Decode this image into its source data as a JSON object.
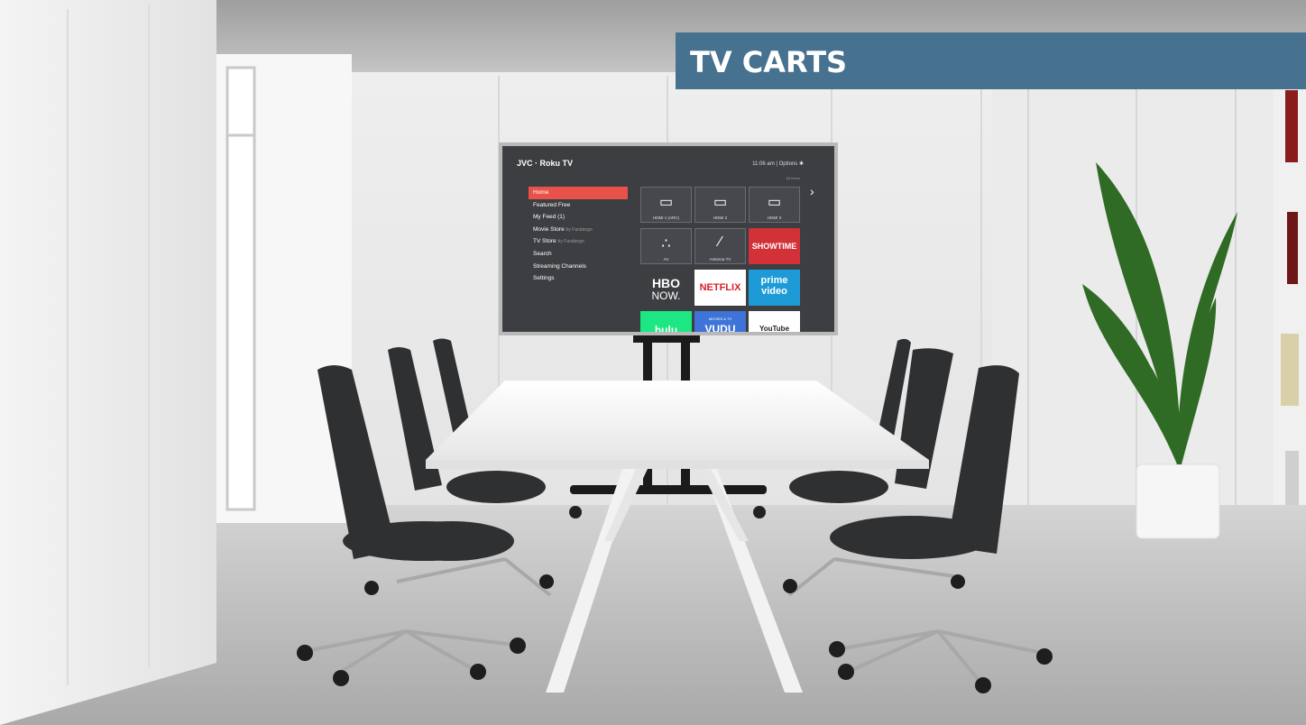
{
  "banner": {
    "title": "TV CARTS"
  },
  "tv": {
    "brand": "JVC · Roku TV",
    "time": "11:06 am  |  Options ✱",
    "items_count": "65 Items",
    "menu": [
      {
        "label": "Home",
        "sub": ""
      },
      {
        "label": "Featured Free",
        "sub": ""
      },
      {
        "label": "My Feed (1)",
        "sub": ""
      },
      {
        "label": "Movie Store",
        "sub": "by Fandango"
      },
      {
        "label": "TV Store",
        "sub": "by Fandango"
      },
      {
        "label": "Search",
        "sub": ""
      },
      {
        "label": "Streaming Channels",
        "sub": ""
      },
      {
        "label": "Settings",
        "sub": ""
      }
    ],
    "tiles": {
      "hdmi1": "HDMI 1 (ARC)",
      "hdmi2": "HDMI 2",
      "hdmi3": "HDMI 3",
      "av": "AV",
      "antenna": "Antenna TV",
      "showtime": "SHOWTIME",
      "hbo_top": "HBO",
      "hbo_bottom": "NOW.",
      "netflix": "NETFLIX",
      "prime_top": "prime",
      "prime_bottom": "video",
      "hulu": "hulu",
      "vudu_top": "MOVIES & TV",
      "vudu": "VUDU",
      "youtube": "YouTube"
    }
  },
  "colors": {
    "banner": "#46728f",
    "menu_active": "#e8524a",
    "wall": "#ececec",
    "floor": "#bdbdbd"
  }
}
